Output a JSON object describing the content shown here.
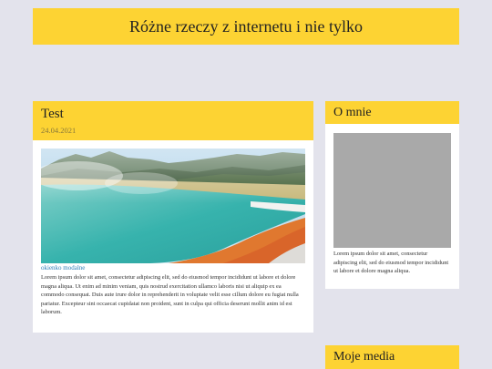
{
  "header": {
    "title": "Różne rzeczy z internetu i nie tylko"
  },
  "post": {
    "title": "Test",
    "date": "24.04.2021",
    "image_alt": "hot spring lake",
    "link_label": "okienko modalne",
    "body": "Lorem ipsum dolor sit amet, consectetur adipiscing elit, sed do eiusmod tempor incididunt ut labore et dolore magna aliqua. Ut enim ad minim veniam, quis nostrud exercitation ullamco laboris nisi ut aliquip ex ea commodo consequat. Duis aute irure dolor in reprehenderit in voluptate velit esse cillum dolore eu fugiat nulla pariatur. Excepteur sint occaecat cupidatat non proident, sunt in culpa qui officia deserunt mollit anim id est laborum."
  },
  "sidebar": {
    "about": {
      "title": "O mnie",
      "text": "Lorem ipsum dolor sit amet, consectetur adipiscing elit, sed do eiusmod tempor incididunt ut labore et dolore magna aliqua."
    },
    "media": {
      "title": "Moje media"
    }
  },
  "colors": {
    "background": "#e3e3ec",
    "accent": "#fdd333",
    "card": "#ffffff",
    "link": "#2f7fb8",
    "placeholder": "#a9a9a9"
  }
}
